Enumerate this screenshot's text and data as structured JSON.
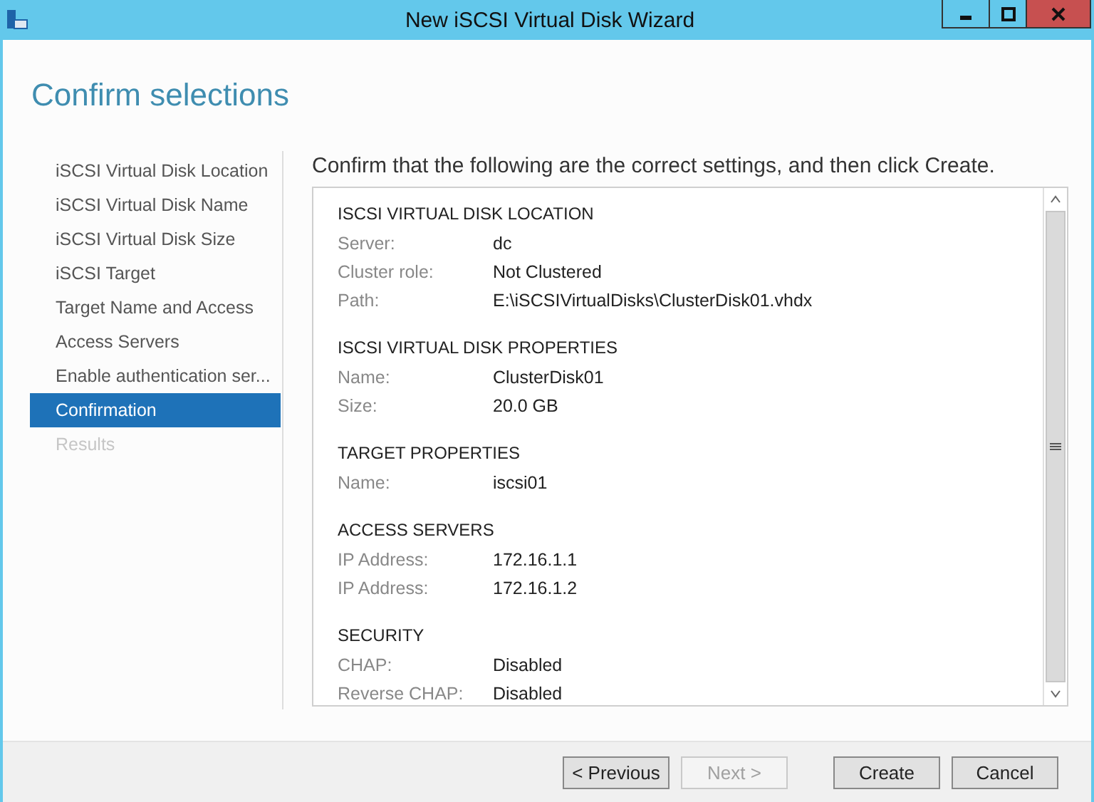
{
  "window": {
    "title": "New iSCSI Virtual Disk Wizard"
  },
  "heading": "Confirm selections",
  "sidebar": {
    "items": [
      {
        "label": "iSCSI Virtual Disk Location",
        "selected": false,
        "disabled": false
      },
      {
        "label": "iSCSI Virtual Disk Name",
        "selected": false,
        "disabled": false
      },
      {
        "label": "iSCSI Virtual Disk Size",
        "selected": false,
        "disabled": false
      },
      {
        "label": "iSCSI Target",
        "selected": false,
        "disabled": false
      },
      {
        "label": "Target Name and Access",
        "selected": false,
        "disabled": false
      },
      {
        "label": "Access Servers",
        "selected": false,
        "disabled": false
      },
      {
        "label": "Enable authentication ser...",
        "selected": false,
        "disabled": false
      },
      {
        "label": "Confirmation",
        "selected": true,
        "disabled": false
      },
      {
        "label": "Results",
        "selected": false,
        "disabled": true
      }
    ]
  },
  "intro": "Confirm that the following are the correct settings, and then click Create.",
  "sections": [
    {
      "title": "ISCSI VIRTUAL DISK LOCATION",
      "rows": [
        {
          "label": "Server:",
          "value": "dc"
        },
        {
          "label": "Cluster role:",
          "value": "Not Clustered"
        },
        {
          "label": "Path:",
          "value": "E:\\iSCSIVirtualDisks\\ClusterDisk01.vhdx"
        }
      ]
    },
    {
      "title": "ISCSI VIRTUAL DISK PROPERTIES",
      "rows": [
        {
          "label": "Name:",
          "value": "ClusterDisk01"
        },
        {
          "label": "Size:",
          "value": "20.0 GB"
        }
      ]
    },
    {
      "title": "TARGET PROPERTIES",
      "rows": [
        {
          "label": "Name:",
          "value": "iscsi01"
        }
      ]
    },
    {
      "title": "ACCESS SERVERS",
      "rows": [
        {
          "label": "IP Address:",
          "value": "172.16.1.1"
        },
        {
          "label": "IP Address:",
          "value": "172.16.1.2"
        }
      ]
    },
    {
      "title": "SECURITY",
      "rows": [
        {
          "label": "CHAP:",
          "value": "Disabled"
        },
        {
          "label": "Reverse CHAP:",
          "value": "Disabled"
        }
      ]
    }
  ],
  "buttons": [
    {
      "label": "< Previous",
      "disabled": false
    },
    {
      "label": "Next >",
      "disabled": true
    },
    {
      "label": "Create",
      "disabled": false
    },
    {
      "label": "Cancel",
      "disabled": false
    }
  ]
}
